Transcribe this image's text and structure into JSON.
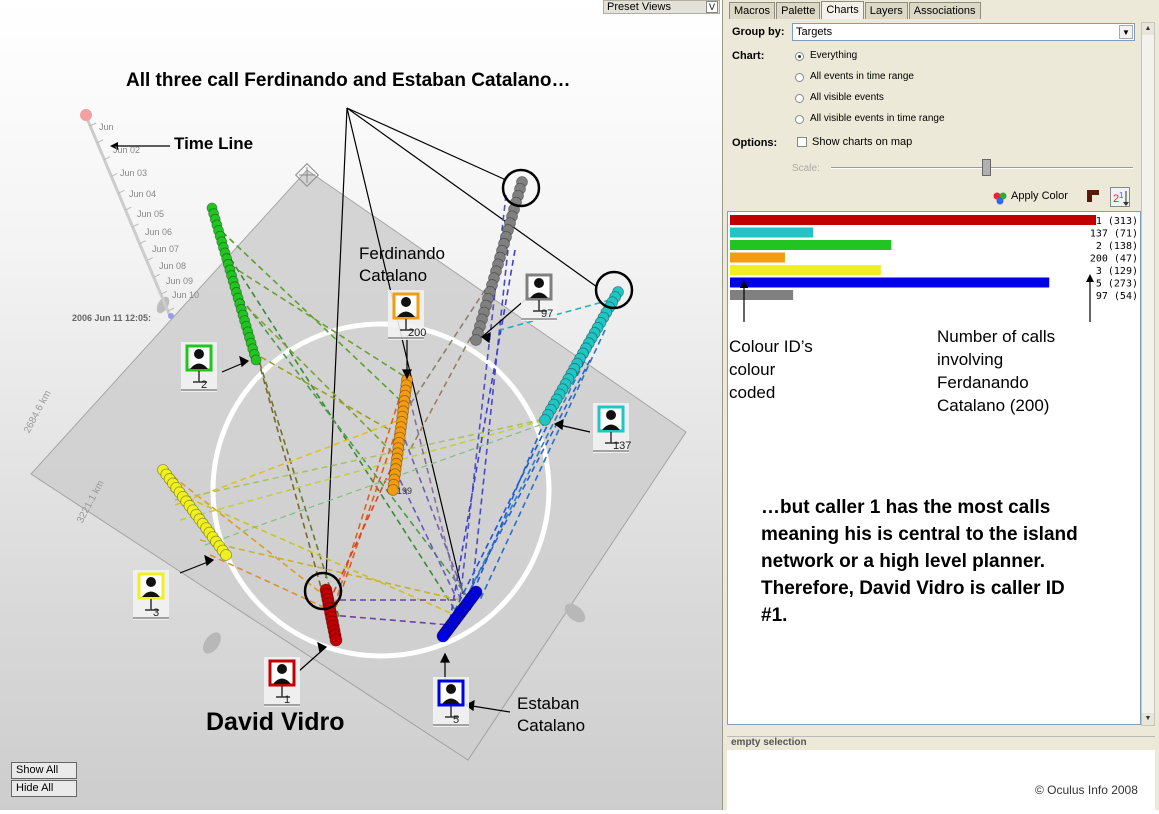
{
  "view": {
    "headline": "All three call Ferdinando and Estaban Catalano…",
    "timeline_label": "Time Line",
    "ferdinando_label": [
      "Ferdinando",
      "Catalano"
    ],
    "david_label": "David Vidro",
    "estaban_label": [
      "Estaban",
      "Catalano"
    ],
    "timeline_ticks": [
      "Jun",
      "Jun 02",
      "Jun 03",
      "Jun 04",
      "Jun 05",
      "Jun 06",
      "Jun 07",
      "Jun 08",
      "Jun 09",
      "Jun 10"
    ],
    "current_time": "2006 Jun 11 12:05:",
    "distance_labels": [
      "2684.6 km",
      "3221.1 km"
    ],
    "preset_views": "Preset Views",
    "preset_views_toggle": "V",
    "show_all": "Show All",
    "hide_all": "Hide All",
    "node_ids": {
      "caller2": "2",
      "caller200": "200",
      "caller97": "97",
      "caller137": "137",
      "caller3": "3",
      "caller1": "1",
      "caller5": "5",
      "caller199": "199"
    }
  },
  "panel": {
    "tabs": [
      "Macros",
      "Palette",
      "Charts",
      "Layers",
      "Associations"
    ],
    "active_tab": "Charts",
    "group_by_label": "Group by:",
    "group_by_value": "Targets",
    "chart_label": "Chart:",
    "chart_options": [
      "Everything",
      "All events in time range",
      "All visible events",
      "All visible events in time range"
    ],
    "chart_selected": "Everything",
    "options_label": "Options:",
    "show_charts_on_map": "Show charts on map",
    "show_charts_checked": false,
    "scale_label": "Scale:",
    "scale_level": 0.51,
    "apply_color": "Apply Color",
    "empty_selection": "empty selection",
    "copyright": "© Oculus Info 2008"
  },
  "annotations": {
    "colour_ids": [
      "Colour ID’s",
      "colour",
      "coded"
    ],
    "number_calls": [
      "Number of calls",
      "involving",
      "Ferdanando",
      "Catalano (200)"
    ],
    "conclusion": "…but caller 1 has the most calls meaning his is central to the island network or a high level planner. Therefore, David Vidro is caller ID #1."
  },
  "chart_data": {
    "type": "bar",
    "orientation": "horizontal",
    "categories": [
      "1",
      "137",
      "2",
      "200",
      "3",
      "5",
      "97"
    ],
    "values": [
      313,
      71,
      138,
      47,
      129,
      273,
      54
    ],
    "bar_labels": [
      "1 (313)",
      "137 (71)",
      "2 (138)",
      "200 (47)",
      "3 (129)",
      "5 (273)",
      "97 (54)"
    ],
    "colors": [
      "#c00000",
      "#22c4c4",
      "#22c422",
      "#f39c12",
      "#f0f020",
      "#0000e6",
      "#808080"
    ],
    "xlim": [
      0,
      313
    ]
  }
}
